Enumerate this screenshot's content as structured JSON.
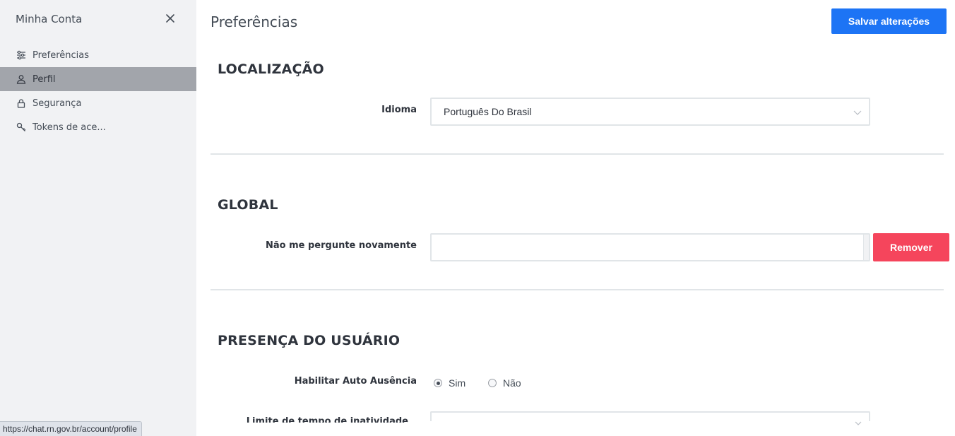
{
  "sidebar": {
    "title": "Minha Conta",
    "close_icon": "close-icon",
    "items": [
      {
        "label": "Preferências",
        "icon": "sliders-icon",
        "active": false
      },
      {
        "label": "Perfil",
        "icon": "user-icon",
        "active": true
      },
      {
        "label": "Segurança",
        "icon": "lock-icon",
        "active": false
      },
      {
        "label": "Tokens de ace...",
        "icon": "key-icon",
        "active": false
      }
    ]
  },
  "status_bar": {
    "url": "https://chat.rn.gov.br/account/profile"
  },
  "header": {
    "title": "Preferências",
    "save_label": "Salvar alterações"
  },
  "sections": {
    "localization": {
      "title": "LOCALIZAÇÃO",
      "language_label": "Idioma",
      "language_value": "Português Do Brasil"
    },
    "global": {
      "title": "GLOBAL",
      "dont_ask_label": "Não me pergunte novamente",
      "dont_ask_value": "",
      "remove_label": "Remover"
    },
    "presence": {
      "title": "PRESENÇA DO USUÁRIO",
      "auto_away_label": "Habilitar Auto Ausência",
      "option_yes": "Sim",
      "option_no": "Não",
      "selected": "Sim",
      "cut_off_label": "Limite de tempo de inatividade"
    }
  },
  "colors": {
    "accent": "#1d74f5",
    "danger": "#f5455c",
    "sidebar_bg": "#f1f2f4",
    "sidebar_active": "#a2a5ab"
  }
}
